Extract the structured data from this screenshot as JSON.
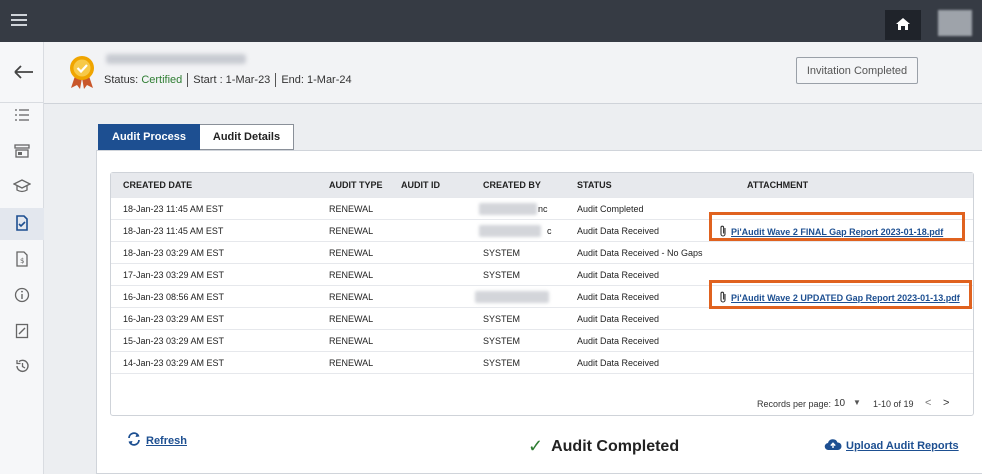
{
  "header": {
    "status_label": "Status:",
    "status_value": "Certified",
    "start": "Start : 1-Mar-23",
    "end": "End: 1-Mar-24",
    "invitation_button": "Invitation Completed"
  },
  "tabs": [
    {
      "label": "Audit Process",
      "active": true
    },
    {
      "label": "Audit Details",
      "active": false
    }
  ],
  "table": {
    "columns": [
      "CREATED DATE",
      "AUDIT TYPE",
      "AUDIT ID",
      "CREATED BY",
      "STATUS",
      "ATTACHMENT"
    ],
    "rows": [
      {
        "date": "18-Jan-23 11:45 AM EST",
        "type": "RENEWAL",
        "id": "",
        "by": "nc",
        "status": "Audit Completed",
        "attachment": ""
      },
      {
        "date": "18-Jan-23 11:45 AM EST",
        "type": "RENEWAL",
        "id": "",
        "by": "c",
        "status": "Audit Data Received",
        "attachment": "Pi'Audit Wave 2 FINAL Gap Report 2023-01-18.pdf"
      },
      {
        "date": "18-Jan-23 03:29 AM EST",
        "type": "RENEWAL",
        "id": "",
        "by": "SYSTEM",
        "status": "Audit Data Received - No Gaps",
        "attachment": ""
      },
      {
        "date": "17-Jan-23 03:29 AM EST",
        "type": "RENEWAL",
        "id": "",
        "by": "SYSTEM",
        "status": "Audit Data Received",
        "attachment": ""
      },
      {
        "date": "16-Jan-23 08:56 AM EST",
        "type": "RENEWAL",
        "id": "",
        "by": "",
        "status": "Audit Data Received",
        "attachment": "Pi'Audit Wave 2 UPDATED Gap Report 2023-01-13.pdf"
      },
      {
        "date": "16-Jan-23 03:29 AM EST",
        "type": "RENEWAL",
        "id": "",
        "by": "SYSTEM",
        "status": "Audit Data Received",
        "attachment": ""
      },
      {
        "date": "15-Jan-23 03:29 AM EST",
        "type": "RENEWAL",
        "id": "",
        "by": "SYSTEM",
        "status": "Audit Data Received",
        "attachment": ""
      },
      {
        "date": "14-Jan-23 03:29 AM EST",
        "type": "RENEWAL",
        "id": "",
        "by": "SYSTEM",
        "status": "Audit Data Received",
        "attachment": ""
      }
    ]
  },
  "pagination": {
    "label": "Records per page:",
    "per_page": "10",
    "range": "1-10 of 19",
    "prev": "<",
    "next": ">"
  },
  "footer": {
    "refresh": "Refresh",
    "completed": "Audit Completed",
    "upload": "Upload Audit Reports"
  },
  "colors": {
    "accent": "#1d4f91",
    "highlight": "#e0621f",
    "success": "#2e7d32",
    "topbar": "#363b44"
  },
  "icons": [
    "menu-icon",
    "home-icon",
    "back-arrow-icon",
    "list-icon",
    "store-icon",
    "graduation-cap-icon",
    "document-check-icon",
    "invoice-icon",
    "info-icon",
    "edit-icon",
    "history-icon",
    "medal-icon",
    "paperclip-icon",
    "refresh-icon",
    "checkmark-icon",
    "cloud-upload-icon"
  ]
}
